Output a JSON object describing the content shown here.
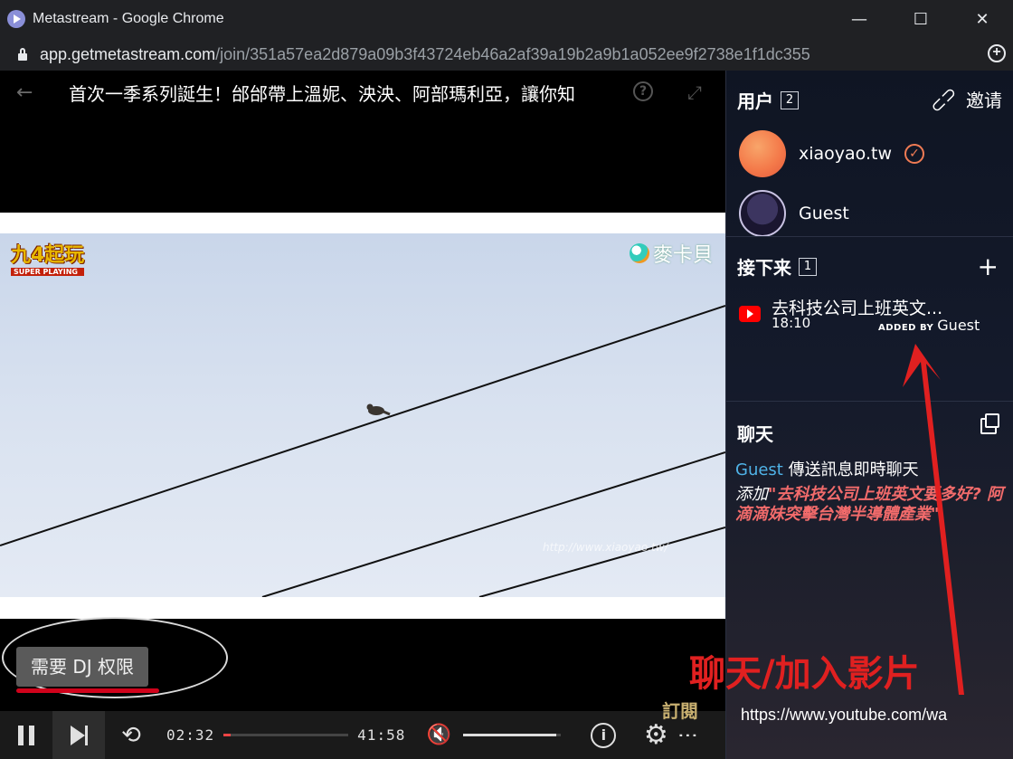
{
  "window": {
    "title": "Metastream - Google Chrome",
    "minimize": "—",
    "maximize": "☐",
    "close": "✕"
  },
  "address": {
    "host": "app.getmetastream.com",
    "path": "/join/351a57ea2d879a09b3f43724eb46a2af39a19b2a9b1a052ee9f2738e1f1dc355"
  },
  "video": {
    "title": "首次一季系列誕生！邰邰帶上溫妮、泱泱、阿部瑪利亞，讓你知",
    "back_icon": "←",
    "help_icon": "?",
    "expand_icon": "⤢",
    "logo_left": "九4起玩",
    "logo_left_sub": "SUPER PLAYING",
    "logo_right": "麥卡貝",
    "watermark": "http://www.xiaoyao.tw/",
    "dj_badge": "需要 DJ 权限"
  },
  "player": {
    "current_time": "02:32",
    "duration": "41:58",
    "progress_fraction": 0.06,
    "volume_fraction": 0.95,
    "repeat_icon": "⟲",
    "mute_icon": "🔇",
    "info_icon": "i",
    "gear_icon": "⚙",
    "more_icon": "⋮",
    "corner_logo": "訂閱"
  },
  "sidebar": {
    "users_label": "用户",
    "users_count": "2",
    "invite_label": "邀请",
    "users": [
      {
        "name": "xiaoyao.tw",
        "verified": true
      },
      {
        "name": "Guest",
        "verified": false
      }
    ],
    "next_label": "接下来",
    "next_count": "1",
    "add_icon": "+",
    "queue": [
      {
        "title": "去科技公司上班英文...",
        "duration": "18:10",
        "added_by_label": "ADDED BY",
        "added_by": "Guest"
      }
    ],
    "chat_label": "聊天",
    "messages": [
      {
        "author": "Guest",
        "text": "傳送訊息即時聊天"
      }
    ],
    "system_message": {
      "prefix": "添加",
      "quoted": "\"去科技公司上班英文要多好? 阿滴滴妹突擊台灣半導體產業\""
    },
    "chat_input_value": "https://www.youtube.com/wa"
  },
  "annotation": {
    "text": "聊天/加入影片",
    "color": "#e02020"
  }
}
